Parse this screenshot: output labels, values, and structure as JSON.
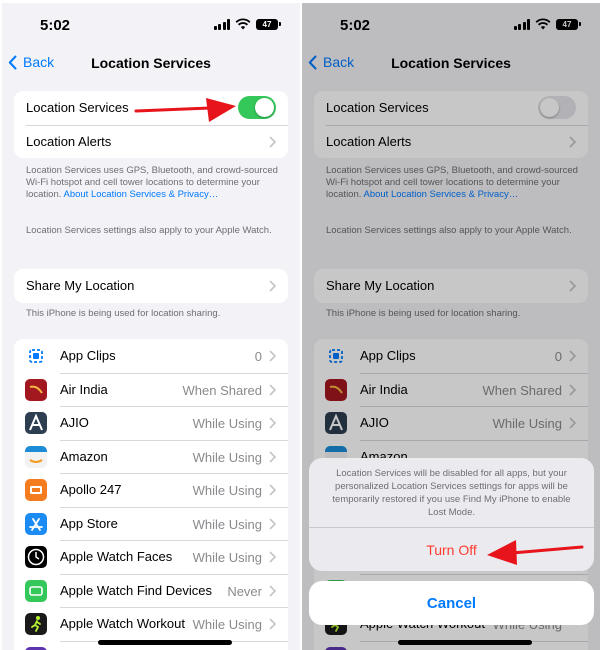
{
  "status": {
    "time": "5:02",
    "battery": "47"
  },
  "nav": {
    "back_label": "Back",
    "title": "Location Services"
  },
  "main_group": {
    "location_services_label": "Location Services",
    "location_alerts_label": "Location Alerts"
  },
  "footer1": {
    "text": "Location Services uses GPS, Bluetooth, and crowd-sourced Wi-Fi hotspot and cell tower locations to determine your location. ",
    "link": "About Location Services & Privacy…"
  },
  "footer2": "Location Services settings also apply to your Apple Watch.",
  "share": {
    "label": "Share My Location",
    "footer": "This iPhone is being used for location sharing."
  },
  "apps": [
    {
      "name": "App Clips",
      "value": "0",
      "icon": "app-clips-icon",
      "color": "#007aff"
    },
    {
      "name": "Air India",
      "value": "When Shared",
      "icon": "air-india-icon",
      "color": "#a3171f"
    },
    {
      "name": "AJIO",
      "value": "While Using",
      "icon": "ajio-icon",
      "color": "#2c3e50"
    },
    {
      "name": "Amazon",
      "value": "While Using",
      "icon": "amazon-icon",
      "color": "#f2f2f2"
    },
    {
      "name": "Apollo 247",
      "value": "While Using",
      "icon": "apollo-icon",
      "color": "#f47b20"
    },
    {
      "name": "App Store",
      "value": "While Using",
      "icon": "app-store-icon",
      "color": "#1c8cf4"
    },
    {
      "name": "Apple Watch Faces",
      "value": "While Using",
      "icon": "watch-faces-icon",
      "color": "#000000"
    },
    {
      "name": "Apple Watch Find Devices",
      "value": "Never",
      "icon": "find-devices-icon",
      "color": "#34c759"
    },
    {
      "name": "Apple Watch Workout",
      "value": "While Using",
      "icon": "workout-icon",
      "color": "#1a1a1a"
    }
  ],
  "alert": {
    "message": "Location Services will be disabled for all apps, but your personalized Location Services settings for apps will be temporarily restored if you use Find My iPhone to enable Lost Mode.",
    "turn_off_label": "Turn Off",
    "cancel_label": "Cancel"
  },
  "colors": {
    "accent": "#007aff",
    "toggle_on": "#34c759",
    "destructive": "#ff3b30",
    "annotation_arrow": "#e8141b"
  }
}
